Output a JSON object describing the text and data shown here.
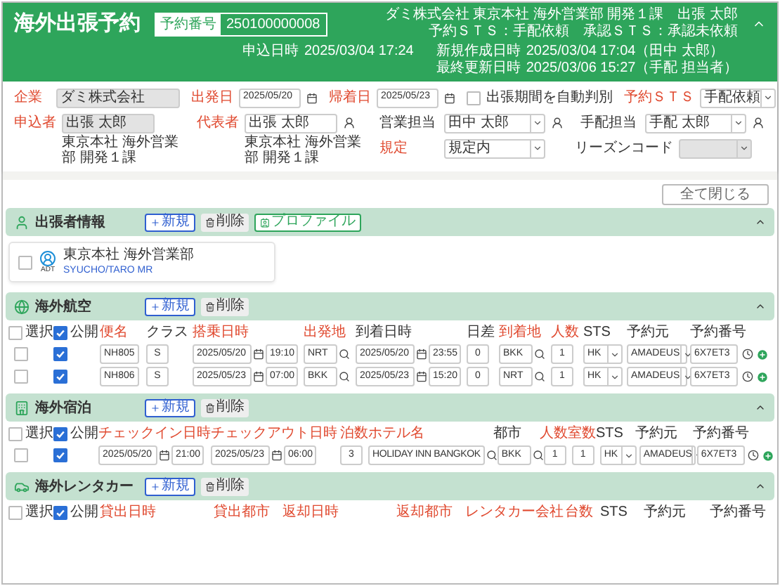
{
  "header": {
    "title": "海外出張予約",
    "booking_number_label": "予約番号",
    "booking_number": "250100000008",
    "org_line": "ダミ株式会社 東京本社 海外営業部 開発１課　出張 太郎",
    "sts_line": "予約ＳＴＳ：手配依頼　承認ＳＴＳ：承認未依頼",
    "applied_label": "申込日時",
    "applied_at": "2025/03/04 17:24",
    "created_label": "新規作成日時",
    "created_at": "2025/03/04 17:04（田中 太郎）",
    "updated_label": "最終更新日時",
    "updated_at": "2025/03/06 15:27（手配 担当者）",
    "expanded": true
  },
  "form": {
    "company": {
      "label": "企業",
      "required": true,
      "value": "ダミ株式会社"
    },
    "departure": {
      "label": "出発日",
      "required": true,
      "value": "2025/05/20"
    },
    "return": {
      "label": "帰着日",
      "required": true,
      "value": "2025/05/23"
    },
    "auto_period": {
      "label": "出張期間を自動判別",
      "checked": false
    },
    "booking_sts": {
      "label": "予約ＳＴＳ",
      "required": true,
      "value": "手配依頼"
    },
    "applicant": {
      "label": "申込者",
      "required": true,
      "value": "出張 太郎",
      "department": "東京本社 海外営業部 開発１課"
    },
    "representative": {
      "label": "代表者",
      "required": true,
      "value": "出張 太郎",
      "department": "東京本社 海外営業部 開発１課"
    },
    "sales_rep": {
      "label": "営業担当",
      "required": false,
      "value": "田中 太郎"
    },
    "arranger": {
      "label": "手配担当",
      "required": false,
      "value": "手配 太郎"
    },
    "policy": {
      "label": "規定",
      "required": true,
      "value": "規定内"
    },
    "reason_code": {
      "label": "リーズンコード",
      "required": false,
      "disabled": true
    }
  },
  "collapse_all_button": "全て閉じる",
  "sections": [
    {
      "kind": "traveler",
      "title": "出張者情報",
      "expanded": true,
      "buttons": [
        {
          "kind": "new",
          "label": "新規"
        },
        {
          "kind": "delete",
          "label": "削除"
        },
        {
          "kind": "profile",
          "label": "プロファイル"
        }
      ],
      "travelers": [
        {
          "checked": false,
          "type": "ADT",
          "department": "東京本社 海外営業部",
          "name": "SYUCHO/TARO MR"
        }
      ]
    },
    {
      "kind": "flight",
      "title": "海外航空",
      "expanded": true,
      "buttons": [
        {
          "kind": "new",
          "label": "新規"
        },
        {
          "kind": "delete",
          "label": "削除"
        }
      ],
      "select": {
        "label": "選択",
        "checked": false
      },
      "public": {
        "label": "公開",
        "checked": true
      },
      "columns": [
        {
          "label": "便名",
          "required": true
        },
        {
          "label": "クラス",
          "required": false
        },
        {
          "label": "搭乗日時",
          "required": true
        },
        {
          "label": "出発地",
          "required": true
        },
        {
          "label": "到着日時",
          "required": false
        },
        {
          "label": "日差",
          "required": false
        },
        {
          "label": "到着地",
          "required": true
        },
        {
          "label": "人数",
          "required": true
        },
        {
          "label": "STS",
          "required": false
        },
        {
          "label": "予約元",
          "required": false
        },
        {
          "label": "予約番号",
          "required": false
        }
      ],
      "rows": [
        {
          "selected": false,
          "public": true,
          "flight_no": "NH805",
          "class": "S",
          "dep_date": "2025/05/20",
          "dep_time": "19:10",
          "origin": "NRT",
          "arr_date": "2025/05/20",
          "arr_time": "23:55",
          "day_diff": "0",
          "destination": "BKK",
          "pax": "1",
          "sts": "HK",
          "source": "AMADEUS",
          "booking_no": "6X7ET3"
        },
        {
          "selected": false,
          "public": true,
          "flight_no": "NH806",
          "class": "S",
          "dep_date": "2025/05/23",
          "dep_time": "07:00",
          "origin": "BKK",
          "arr_date": "2025/05/23",
          "arr_time": "15:20",
          "day_diff": "0",
          "destination": "NRT",
          "pax": "1",
          "sts": "HK",
          "source": "AMADEUS",
          "booking_no": "6X7ET3"
        }
      ]
    },
    {
      "kind": "hotel",
      "title": "海外宿泊",
      "expanded": true,
      "buttons": [
        {
          "kind": "new",
          "label": "新規"
        },
        {
          "kind": "delete",
          "label": "削除"
        }
      ],
      "select": {
        "label": "選択",
        "checked": false
      },
      "public": {
        "label": "公開",
        "checked": true
      },
      "columns": [
        {
          "label": "チェックイン日時",
          "required": true
        },
        {
          "label": "チェックアウト日時",
          "required": true
        },
        {
          "label": "泊数",
          "required": true
        },
        {
          "label": "ホテル名",
          "required": true
        },
        {
          "label": "都市",
          "required": false
        },
        {
          "label": "人数",
          "required": true
        },
        {
          "label": "室数",
          "required": true
        },
        {
          "label": "STS",
          "required": false
        },
        {
          "label": "予約元",
          "required": false
        },
        {
          "label": "予約番号",
          "required": false
        }
      ],
      "rows": [
        {
          "selected": false,
          "public": true,
          "in_date": "2025/05/20",
          "in_time": "21:00",
          "out_date": "2025/05/23",
          "out_time": "06:00",
          "nights": "3",
          "hotel": "HOLIDAY INN BANGKOK",
          "city": "BKK",
          "pax": "1",
          "rooms": "1",
          "sts": "HK",
          "source": "AMADEUS",
          "booking_no": "6X7ET3"
        }
      ]
    },
    {
      "kind": "rental",
      "title": "海外レンタカー",
      "expanded": true,
      "buttons": [
        {
          "kind": "new",
          "label": "新規"
        },
        {
          "kind": "delete",
          "label": "削除"
        }
      ],
      "select": {
        "label": "選択",
        "checked": false
      },
      "public": {
        "label": "公開",
        "checked": true
      },
      "columns": [
        {
          "label": "貸出日時",
          "required": true
        },
        {
          "label": "貸出都市",
          "required": true
        },
        {
          "label": "返却日時",
          "required": true
        },
        {
          "label": "返却都市",
          "required": true
        },
        {
          "label": "レンタカー会社",
          "required": true
        },
        {
          "label": "台数",
          "required": true
        },
        {
          "label": "STS",
          "required": false
        },
        {
          "label": "予約元",
          "required": false
        },
        {
          "label": "予約番号",
          "required": false
        }
      ]
    }
  ]
}
